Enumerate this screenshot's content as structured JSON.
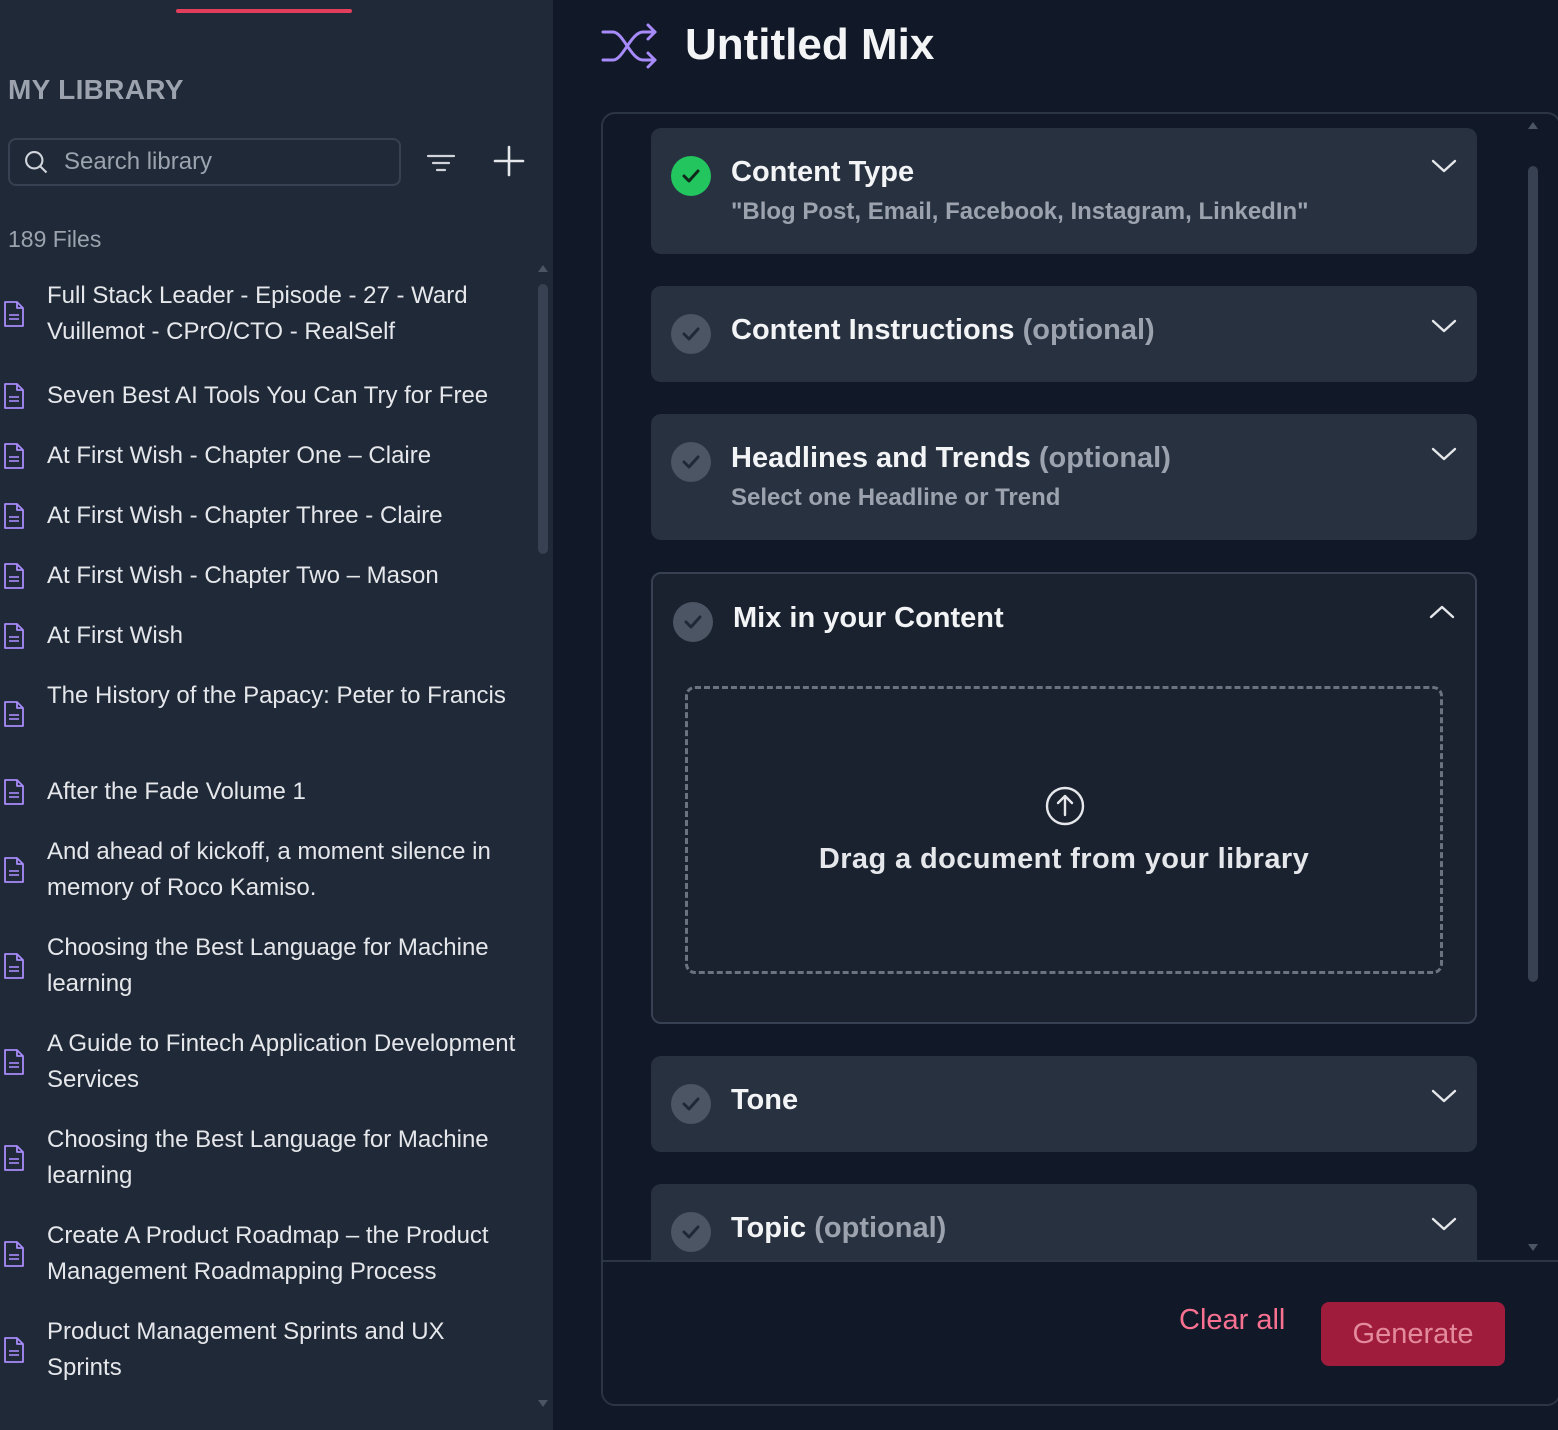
{
  "sidebar": {
    "title": "MY LIBRARY",
    "search_placeholder": "Search library",
    "file_count": "189 Files",
    "files": [
      "Full Stack Leader - Episode - 27 - Ward Vuillemot - CPrO/CTO - RealSelf",
      "Seven Best AI Tools You Can Try for Free",
      "At First Wish - Chapter One – Claire",
      "At First Wish - Chapter Three - Claire",
      "At First Wish - Chapter Two – Mason",
      "At First Wish",
      "The History of the Papacy: Peter to Francis",
      "After the Fade Volume 1",
      "And ahead of kickoff, a moment silence in memory of Roco Kamiso.",
      "Choosing the Best Language for Machine learning",
      "A Guide to Fintech Application Development Services",
      "Choosing the Best Language for Machine learning",
      "Create A Product Roadmap – the Product Management Roadmapping Process",
      "Product Management Sprints and UX Sprints"
    ]
  },
  "main": {
    "title": "Untitled Mix",
    "sections": {
      "content_type": {
        "title": "Content Type",
        "value": "\"Blog Post, Email, Facebook, Instagram, LinkedIn\""
      },
      "content_instructions": {
        "title": "Content Instructions",
        "optional": "(optional)"
      },
      "headlines": {
        "title": "Headlines and Trends",
        "optional": "(optional)",
        "subtitle": "Select one Headline or Trend"
      },
      "mix_content": {
        "title": "Mix in your Content",
        "dropzone_text": "Drag a document from your library"
      },
      "tone": {
        "title": "Tone"
      },
      "topic": {
        "title": "Topic",
        "optional": "(optional)"
      }
    },
    "footer": {
      "clear_label": "Clear all",
      "generate_label": "Generate"
    }
  },
  "colors": {
    "accent": "#e23d5a",
    "success": "#22c55e",
    "generate_bg": "#9f1c3d",
    "mix_icon": "#a78bfa"
  }
}
